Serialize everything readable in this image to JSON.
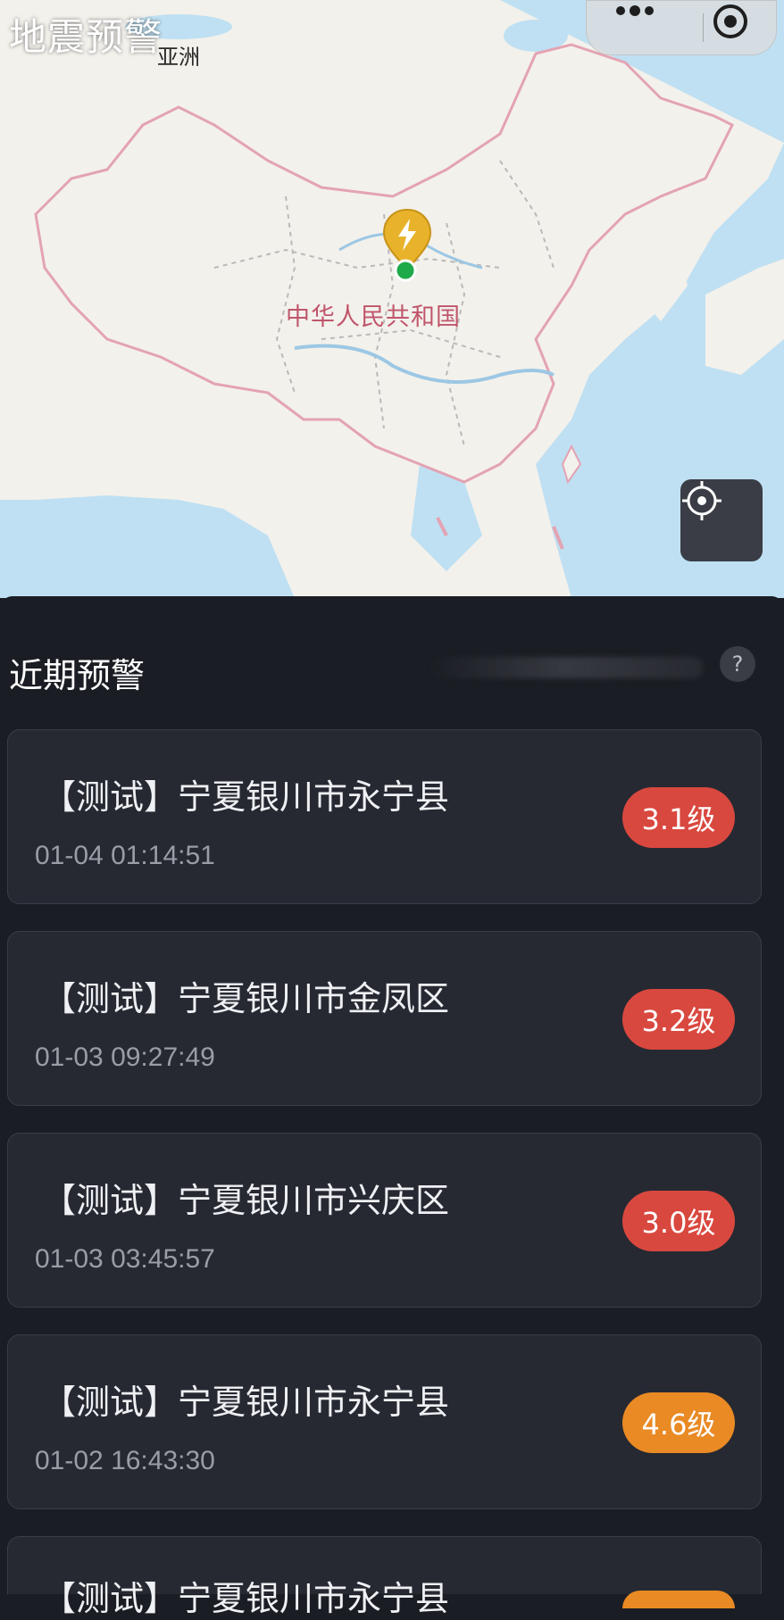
{
  "app": {
    "title": "地震预警"
  },
  "map": {
    "continent_label": "亚洲",
    "country_label": "中华人民共和国",
    "colors": {
      "land": "#f3f1ec",
      "water": "#bfe0f2",
      "border": "#e3a3b3",
      "river": "#9cc7e4"
    },
    "marker_icon": "lightning-pin-icon"
  },
  "recent": {
    "title": "近期预警",
    "help_label": "?",
    "items": [
      {
        "place": "【测试】宁夏银川市永宁县",
        "time": "01-04 01:14:51",
        "magnitude": "3.1级",
        "level_color": "#d9483f"
      },
      {
        "place": "【测试】宁夏银川市金凤区",
        "time": "01-03 09:27:49",
        "magnitude": "3.2级",
        "level_color": "#d9483f"
      },
      {
        "place": "【测试】宁夏银川市兴庆区",
        "time": "01-03 03:45:57",
        "magnitude": "3.0级",
        "level_color": "#d9483f"
      },
      {
        "place": "【测试】宁夏银川市永宁县",
        "time": "01-02 16:43:30",
        "magnitude": "4.6级",
        "level_color": "#e98a24"
      },
      {
        "place": "【测试】宁夏银川市永宁县",
        "time": "",
        "magnitude": "",
        "level_color": "#e98a24"
      }
    ]
  }
}
